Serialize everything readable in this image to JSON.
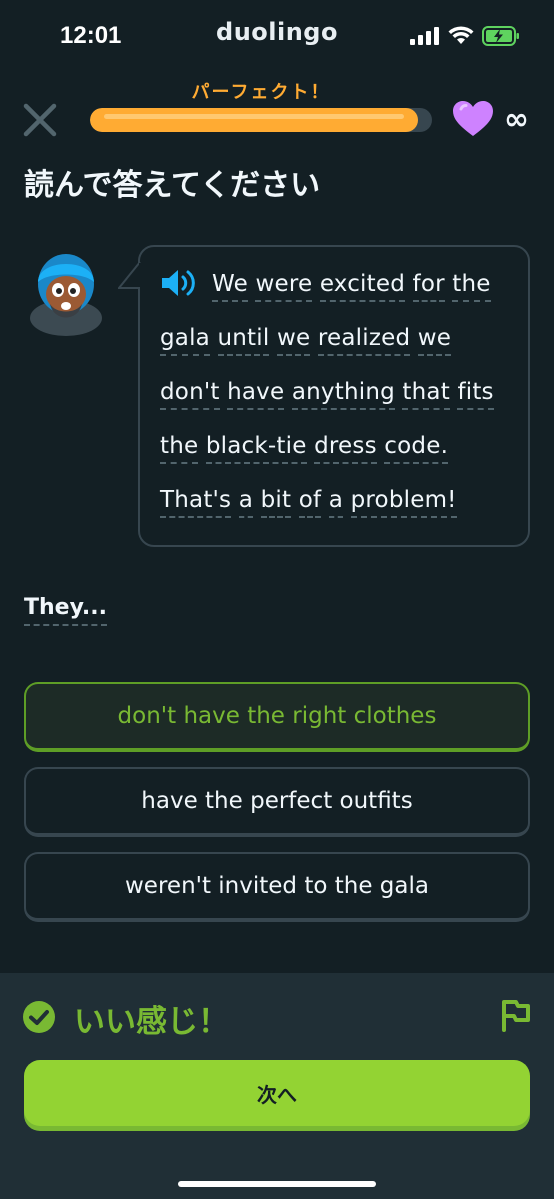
{
  "status_bar": {
    "time": "12:01",
    "app_name": "duolingo"
  },
  "header": {
    "streak_label": "パーフェクト！",
    "progress_fraction": 0.96,
    "hearts_value": "∞"
  },
  "prompt_title": "読んで答えてください",
  "passage": {
    "lines": [
      [
        "We",
        "were",
        "excited",
        "for",
        "the"
      ],
      [
        "gala",
        "until",
        "we",
        "realized",
        "we"
      ],
      [
        "don't",
        "have",
        "anything",
        "that",
        "fits"
      ],
      [
        "the",
        "black-tie",
        "dress",
        "code."
      ],
      [
        "That's",
        "a",
        "bit",
        "of",
        "a",
        "problem!"
      ]
    ]
  },
  "question": "They...",
  "options": [
    {
      "label": "don't have the right clothes",
      "state": "correct"
    },
    {
      "label": "have the perfect outfits",
      "state": "default"
    },
    {
      "label": "weren't invited to the gala",
      "state": "default"
    }
  ],
  "feedback": {
    "message": "いい感じ！",
    "continue_label": "次へ"
  },
  "colors": {
    "background": "#131f24",
    "progress": "#ffab33",
    "heart": "#ce82ff",
    "correct_green": "#79b933",
    "button_green": "#93d333",
    "speaker_blue": "#1cb0f6"
  }
}
